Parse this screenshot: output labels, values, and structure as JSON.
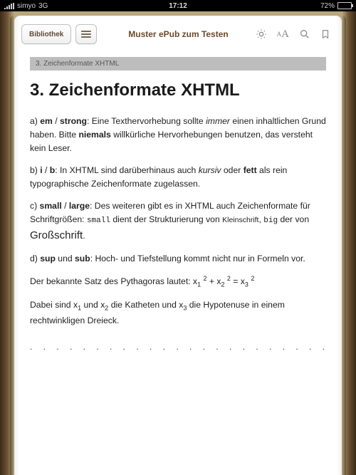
{
  "status": {
    "carrier": "simyo",
    "network": "3G",
    "time": "17:12",
    "battery_pct": "72%"
  },
  "toolbar": {
    "library_label": "Bibliothek",
    "title": "Muster ePub zum Testen",
    "icons": {
      "toc": "toc-icon",
      "brightness": "brightness-icon",
      "font": "font-size-icon",
      "search": "search-icon",
      "bookmark": "bookmark-icon"
    }
  },
  "chapter_bar": "3. Zeichenformate XHTML",
  "heading": "3. Zeichenformate XHTML",
  "para_a": {
    "prefix": "a) ",
    "em": "em",
    "sep1": " / ",
    "strong": "strong",
    "t1": ": Eine Texthervorhebung sollte ",
    "immer": "immer",
    "t2": " einen inhaltlichen Grund haben. Bitte ",
    "niemals": "niemals",
    "t3": " willkürliche Hervorhebungen benutzen, das versteht kein Leser."
  },
  "para_b": {
    "prefix": "b) ",
    "i": "i",
    "sep1": " / ",
    "b": "b",
    "t1": ": In XHTML sind darüberhinaus auch ",
    "kursiv": "kursiv",
    "t2": " oder ",
    "fett": "fett",
    "t3": " als rein typographische Zeichenformate zugelassen."
  },
  "para_c": {
    "prefix": "c) ",
    "small": "small",
    "sep1": " / ",
    "large": "large",
    "t1": ": Des weiteren gibt es in XHTML auch Zeichenformate für Schriftgrößen: ",
    "small_code": "small",
    "t2": " dient der Strukturierung von ",
    "klein": "Kleinschrift",
    "t3": ", ",
    "big_code": "big",
    "t4": " der von ",
    "gross": "Großschrift",
    "t5": "."
  },
  "para_d": {
    "prefix": "d) ",
    "sup": "sup",
    "und": " und ",
    "sub": "sub",
    "t1": ": Hoch- und Tiefstellung kommt nicht nur in Formeln vor."
  },
  "pyth": {
    "t1": "Der bekannte Satz des Pythagoras lautet: x",
    "s1": "1",
    "sp": " ",
    "p2a": "2",
    "t2": " + x",
    "s2": "2",
    "p2b": "2",
    "t3": " = x",
    "s3": "3",
    "p2c": "2"
  },
  "kath": {
    "t1": "Dabei sind x",
    "s1": "1",
    "t2": " und x",
    "s2": "2",
    "t3": " die Katheten und x",
    "s3": "3",
    "t4": " die Hypotenuse in einem rechtwinkligen Dreieck."
  },
  "dots": ". . . . . . . . . . . . . . . . . . . . . . . . . . . . . . . . . ."
}
